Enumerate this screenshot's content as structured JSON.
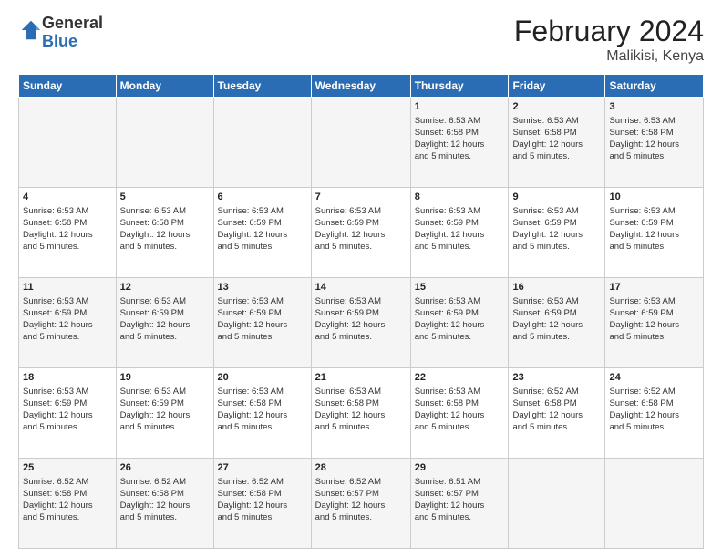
{
  "logo": {
    "general": "General",
    "blue": "Blue"
  },
  "header": {
    "month": "February 2024",
    "location": "Malikisi, Kenya"
  },
  "weekdays": [
    "Sunday",
    "Monday",
    "Tuesday",
    "Wednesday",
    "Thursday",
    "Friday",
    "Saturday"
  ],
  "weeks": [
    [
      {
        "day": "",
        "info": ""
      },
      {
        "day": "",
        "info": ""
      },
      {
        "day": "",
        "info": ""
      },
      {
        "day": "",
        "info": ""
      },
      {
        "day": "1",
        "info": "Sunrise: 6:53 AM\nSunset: 6:58 PM\nDaylight: 12 hours\nand 5 minutes."
      },
      {
        "day": "2",
        "info": "Sunrise: 6:53 AM\nSunset: 6:58 PM\nDaylight: 12 hours\nand 5 minutes."
      },
      {
        "day": "3",
        "info": "Sunrise: 6:53 AM\nSunset: 6:58 PM\nDaylight: 12 hours\nand 5 minutes."
      }
    ],
    [
      {
        "day": "4",
        "info": "Sunrise: 6:53 AM\nSunset: 6:58 PM\nDaylight: 12 hours\nand 5 minutes."
      },
      {
        "day": "5",
        "info": "Sunrise: 6:53 AM\nSunset: 6:58 PM\nDaylight: 12 hours\nand 5 minutes."
      },
      {
        "day": "6",
        "info": "Sunrise: 6:53 AM\nSunset: 6:59 PM\nDaylight: 12 hours\nand 5 minutes."
      },
      {
        "day": "7",
        "info": "Sunrise: 6:53 AM\nSunset: 6:59 PM\nDaylight: 12 hours\nand 5 minutes."
      },
      {
        "day": "8",
        "info": "Sunrise: 6:53 AM\nSunset: 6:59 PM\nDaylight: 12 hours\nand 5 minutes."
      },
      {
        "day": "9",
        "info": "Sunrise: 6:53 AM\nSunset: 6:59 PM\nDaylight: 12 hours\nand 5 minutes."
      },
      {
        "day": "10",
        "info": "Sunrise: 6:53 AM\nSunset: 6:59 PM\nDaylight: 12 hours\nand 5 minutes."
      }
    ],
    [
      {
        "day": "11",
        "info": "Sunrise: 6:53 AM\nSunset: 6:59 PM\nDaylight: 12 hours\nand 5 minutes."
      },
      {
        "day": "12",
        "info": "Sunrise: 6:53 AM\nSunset: 6:59 PM\nDaylight: 12 hours\nand 5 minutes."
      },
      {
        "day": "13",
        "info": "Sunrise: 6:53 AM\nSunset: 6:59 PM\nDaylight: 12 hours\nand 5 minutes."
      },
      {
        "day": "14",
        "info": "Sunrise: 6:53 AM\nSunset: 6:59 PM\nDaylight: 12 hours\nand 5 minutes."
      },
      {
        "day": "15",
        "info": "Sunrise: 6:53 AM\nSunset: 6:59 PM\nDaylight: 12 hours\nand 5 minutes."
      },
      {
        "day": "16",
        "info": "Sunrise: 6:53 AM\nSunset: 6:59 PM\nDaylight: 12 hours\nand 5 minutes."
      },
      {
        "day": "17",
        "info": "Sunrise: 6:53 AM\nSunset: 6:59 PM\nDaylight: 12 hours\nand 5 minutes."
      }
    ],
    [
      {
        "day": "18",
        "info": "Sunrise: 6:53 AM\nSunset: 6:59 PM\nDaylight: 12 hours\nand 5 minutes."
      },
      {
        "day": "19",
        "info": "Sunrise: 6:53 AM\nSunset: 6:59 PM\nDaylight: 12 hours\nand 5 minutes."
      },
      {
        "day": "20",
        "info": "Sunrise: 6:53 AM\nSunset: 6:58 PM\nDaylight: 12 hours\nand 5 minutes."
      },
      {
        "day": "21",
        "info": "Sunrise: 6:53 AM\nSunset: 6:58 PM\nDaylight: 12 hours\nand 5 minutes."
      },
      {
        "day": "22",
        "info": "Sunrise: 6:53 AM\nSunset: 6:58 PM\nDaylight: 12 hours\nand 5 minutes."
      },
      {
        "day": "23",
        "info": "Sunrise: 6:52 AM\nSunset: 6:58 PM\nDaylight: 12 hours\nand 5 minutes."
      },
      {
        "day": "24",
        "info": "Sunrise: 6:52 AM\nSunset: 6:58 PM\nDaylight: 12 hours\nand 5 minutes."
      }
    ],
    [
      {
        "day": "25",
        "info": "Sunrise: 6:52 AM\nSunset: 6:58 PM\nDaylight: 12 hours\nand 5 minutes."
      },
      {
        "day": "26",
        "info": "Sunrise: 6:52 AM\nSunset: 6:58 PM\nDaylight: 12 hours\nand 5 minutes."
      },
      {
        "day": "27",
        "info": "Sunrise: 6:52 AM\nSunset: 6:58 PM\nDaylight: 12 hours\nand 5 minutes."
      },
      {
        "day": "28",
        "info": "Sunrise: 6:52 AM\nSunset: 6:57 PM\nDaylight: 12 hours\nand 5 minutes."
      },
      {
        "day": "29",
        "info": "Sunrise: 6:51 AM\nSunset: 6:57 PM\nDaylight: 12 hours\nand 5 minutes."
      },
      {
        "day": "",
        "info": ""
      },
      {
        "day": "",
        "info": ""
      }
    ]
  ]
}
